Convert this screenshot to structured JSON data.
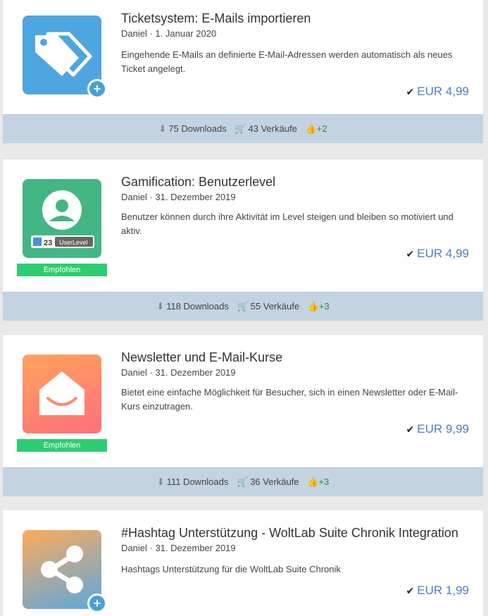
{
  "items": [
    {
      "title": "Ticketsystem: E-Mails importieren",
      "author": "Daniel",
      "date": "1. Januar 2020",
      "description": "Eingehende E-Mails an definierte E-Mail-Adressen werden automatisch als neues Ticket angelegt.",
      "price": "EUR 4,99",
      "downloads": "75 Downloads",
      "sales": "43 Verkäufe",
      "likes": "+2",
      "icon": "tags-icon",
      "badge": ""
    },
    {
      "title": "Gamification: Benutzerlevel",
      "author": "Daniel",
      "date": "31. Dezember 2019",
      "description": "Benutzer können durch ihre Aktivität im Level steigen und bleiben so motiviert und aktiv.",
      "price": "EUR 4,99",
      "downloads": "118 Downloads",
      "sales": "55 Verkäufe",
      "likes": "+3",
      "icon": "user-level-icon",
      "level_number": "23",
      "level_label": "UserLevel",
      "badge": "Empfohlen"
    },
    {
      "title": "Newsletter und E-Mail-Kurse",
      "author": "Daniel",
      "date": "31. Dezember 2019",
      "description": "Bietet eine einfache Möglichkeit für Besucher, sich in einen Newsletter oder E-Mail-Kurs einzutragen.",
      "price": "EUR 9,99",
      "downloads": "111 Downloads",
      "sales": "36 Verkäufe",
      "likes": "+3",
      "icon": "envelope-icon",
      "badge": "Empfohlen"
    },
    {
      "title": "#Hashtag Unterstützung - WoltLab Suite Chronik Integration",
      "author": "Daniel",
      "date": "31. Dezember 2019",
      "description": "Hashtags Unterstützung für die WoltLab Suite Chronik",
      "price": "EUR 1,99",
      "icon": "share-icon",
      "badge": ""
    }
  ],
  "meta_separator": "·",
  "colors": {
    "price": "#4a7fc1",
    "footer_bg": "#c4d3e2",
    "badge_green": "#2ecc71",
    "like_green": "#2e8b2e"
  }
}
